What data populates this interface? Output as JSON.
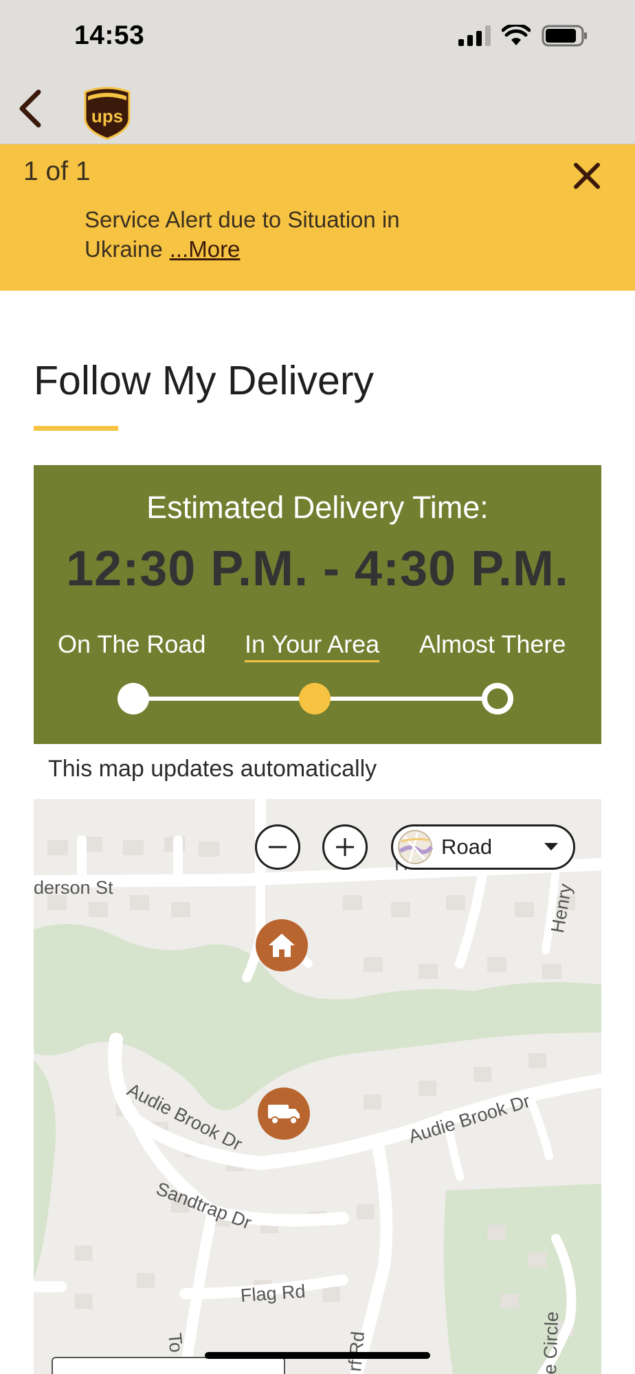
{
  "status_bar": {
    "time": "14:53"
  },
  "header": {
    "logo": "UPS"
  },
  "alert": {
    "count": "1 of 1",
    "message": "Service Alert due to Situation in Ukraine",
    "more_label": "...More"
  },
  "page": {
    "title": "Follow My Delivery"
  },
  "delivery": {
    "label": "Estimated Delivery Time:",
    "time_window": "12:30 P.M. - 4:30 P.M.",
    "steps": [
      "On The Road",
      "In Your Area",
      "Almost There"
    ],
    "current_step": 1
  },
  "map": {
    "note": "This map updates automatically",
    "style_selector": {
      "selected": "Road",
      "options_visible": [
        "Road"
      ]
    },
    "streets": [
      "derson St",
      "Henderson St",
      "Henry",
      "Audie Brook Dr",
      "Audie Brook Dr",
      "Sandtrap Dr",
      "Flag Rd",
      "To",
      "rf Rd",
      "e Circle"
    ],
    "markers": [
      "home-icon",
      "truck-icon"
    ]
  },
  "colors": {
    "brand_gold": "#f6c342",
    "brand_brown": "#3b1a0c",
    "panel_olive": "#727f30",
    "marker_brown": "#b8652f"
  }
}
